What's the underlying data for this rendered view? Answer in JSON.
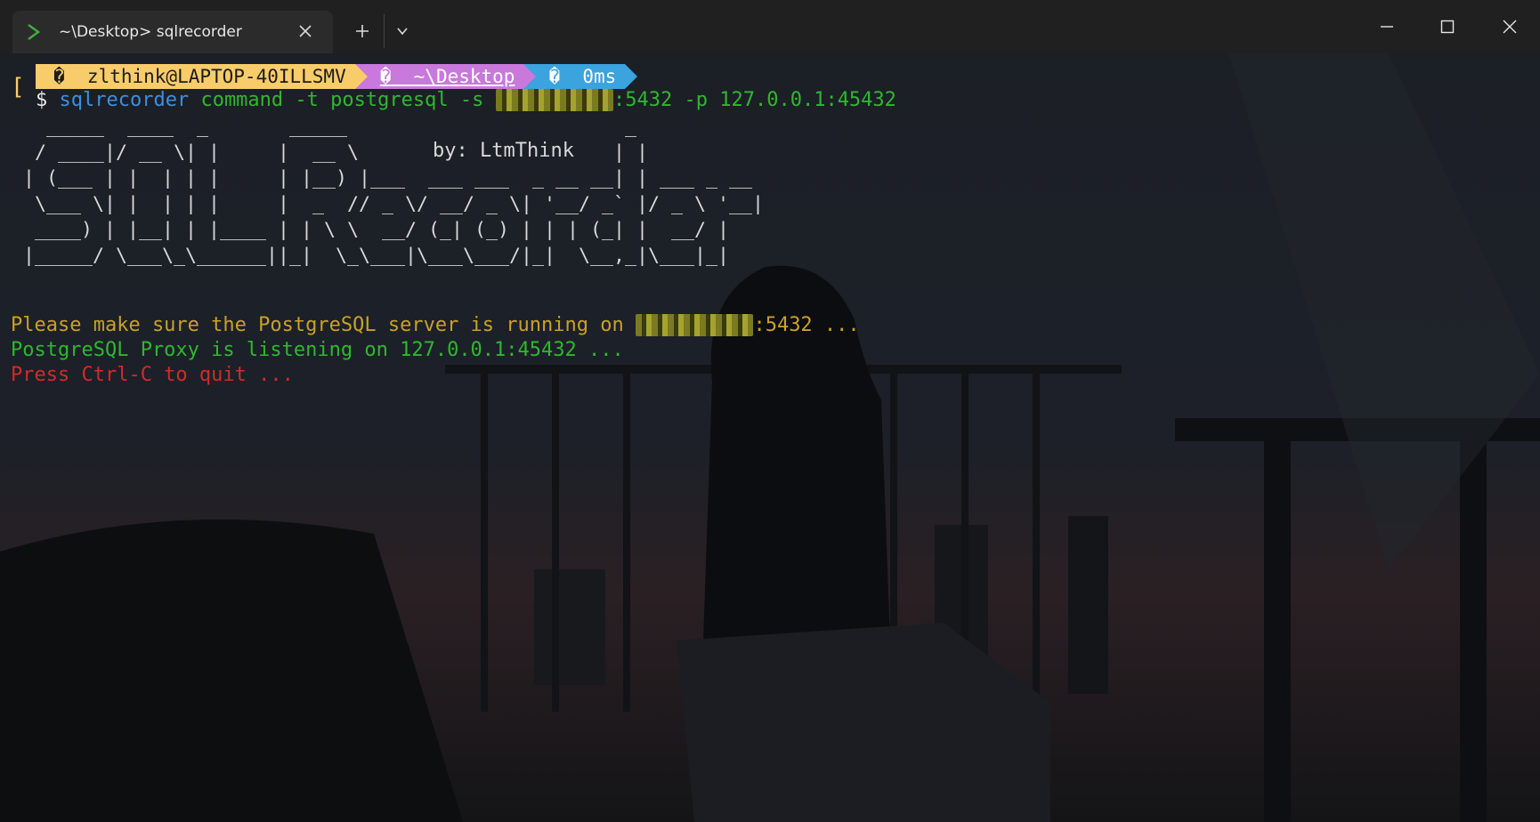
{
  "window": {
    "tab_title": "~\\Desktop> sqlrecorder",
    "new_tab_icon": "plus-icon",
    "dropdown_icon": "chevron-down-icon",
    "minimize_icon": "minimize-icon",
    "maximize_icon": "maximize-icon",
    "close_icon": "close-icon"
  },
  "prompt": {
    "user_segment": "�  zlthink@LAPTOP-40ILLSMV",
    "path_segment": "�  ~\\Desktop",
    "time_segment": "�  0ms",
    "dollar": "$",
    "command_name": "sqlrecorder",
    "command_args_before": " command -t postgresql -s ",
    "command_args_after": ":5432 -p 127.0.0.1:45432"
  },
  "banner": {
    "ascii": "  _____  ____  _       _____                        _ \n / ____|/ __ \\| |     |  __ \\                      | |\n| (___ | |  | | |     | |__) |___  ___ ___  _ __ __| | ___ _ __\n \\___ \\| |  | | |     |  _  // _ \\/ __/ _ \\| '__/ _` |/ _ \\ '__|\n ____) | |__| | |____ | | \\ \\  __/ (_| (_) | | | (_| |  __/ |\n|_____/ \\___\\_\\______||_|  \\_\\___|\\___\\___/|_|  \\__,_|\\___|_|",
    "byline": "by: LtmThink"
  },
  "output": {
    "line1_before": "Please make sure the PostgreSQL server is running on ",
    "line1_after": ":5432 ...",
    "line2": "PostgreSQL Proxy is listening on 127.0.0.1:45432 ...",
    "line3": "Press Ctrl-C to quit ..."
  },
  "colors": {
    "yellow": "#c9a227",
    "green": "#2fb82f",
    "red": "#d42a2a",
    "blue": "#3b8fe0",
    "prompt_yellow": "#f9cc6b",
    "prompt_purple": "#c978dc",
    "prompt_blue": "#3ba3dd"
  }
}
